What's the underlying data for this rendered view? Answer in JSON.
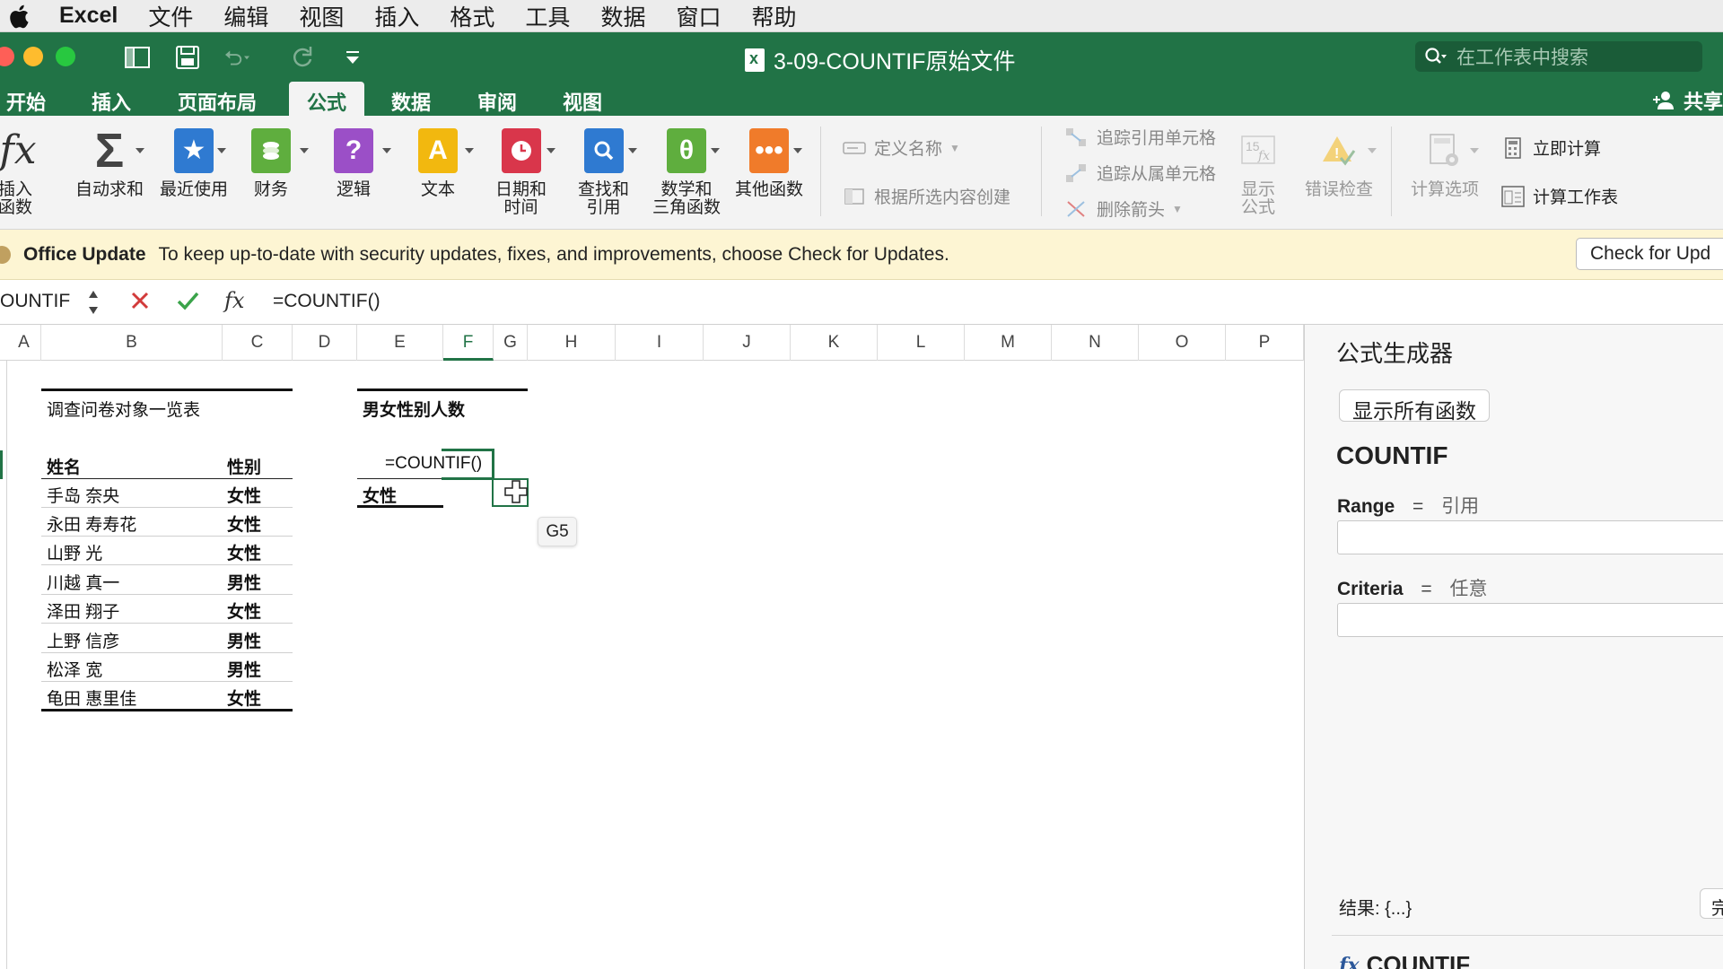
{
  "menubar": {
    "app": "Excel",
    "items": [
      "文件",
      "编辑",
      "视图",
      "插入",
      "格式",
      "工具",
      "数据",
      "窗口",
      "帮助"
    ]
  },
  "titlebar": {
    "document_title": "3-09-COUNTIF原始文件",
    "search_placeholder": "在工作表中搜索"
  },
  "ribbon_tabs": {
    "items": [
      "开始",
      "插入",
      "页面布局",
      "公式",
      "数据",
      "审阅",
      "视图"
    ],
    "active": "公式",
    "share": "共享"
  },
  "ribbon": {
    "insert_function": "插入\n函数",
    "buttons": [
      {
        "label": "自动求和"
      },
      {
        "label": "最近使用"
      },
      {
        "label": "财务"
      },
      {
        "label": "逻辑"
      },
      {
        "label": "文本"
      },
      {
        "label": "日期和\n时间"
      },
      {
        "label": "查找和\n引用"
      },
      {
        "label": "数学和\n三角函数"
      },
      {
        "label": "其他函数"
      }
    ],
    "define_name": "定义名称",
    "create_from_selection": "根据所选内容创建",
    "trace_precedents": "追踪引用单元格",
    "trace_dependents": "追踪从属单元格",
    "remove_arrows": "删除箭头",
    "show_formulas": "显示\n公式",
    "error_checking": "错误检查",
    "calc_options": "计算选项",
    "calc_now": "立即计算",
    "calc_sheet": "计算工作表",
    "colors": {
      "green": "#217346",
      "ribbon_bg": "#f3f3f3"
    }
  },
  "update_bar": {
    "title": "Office Update",
    "message": "To keep up-to-date with security updates, fixes, and improvements, choose Check for Updates.",
    "button": "Check for Upd"
  },
  "formula_bar": {
    "name_box": "OUNTIF",
    "formula": "=COUNTIF()"
  },
  "columns": [
    "A",
    "B",
    "C",
    "D",
    "E",
    "F",
    "G",
    "H",
    "I",
    "J",
    "K",
    "L",
    "M",
    "N",
    "O",
    "P"
  ],
  "selected_column": "F",
  "sheet": {
    "table1_title": "调查问卷对象一览表",
    "header_name": "姓名",
    "header_gender": "性别",
    "rows": [
      {
        "name": "手岛 奈央",
        "gender": "女性"
      },
      {
        "name": "永田 寿寿花",
        "gender": "女性"
      },
      {
        "name": "山野 光",
        "gender": "女性"
      },
      {
        "name": "川越 真一",
        "gender": "男性"
      },
      {
        "name": "泽田 翔子",
        "gender": "女性"
      },
      {
        "name": "上野 信彦",
        "gender": "男性"
      },
      {
        "name": "松泽 宽",
        "gender": "男性"
      },
      {
        "name": "龟田 惠里佳",
        "gender": "女性"
      }
    ],
    "table2_title": "男女性别人数",
    "editing_formula": "=COUNTIF()",
    "female_label": "女性",
    "tooltip": "G5"
  },
  "formula_builder": {
    "title": "公式生成器",
    "back_button": "显示所有函数",
    "function_name": "COUNTIF",
    "args": [
      {
        "name": "Range",
        "eq": "=",
        "type": "引用"
      },
      {
        "name": "Criteria",
        "eq": "=",
        "type": "任意"
      }
    ],
    "result": "结果: {...}",
    "done_button": "完",
    "footer_function": "COUNTIF"
  }
}
